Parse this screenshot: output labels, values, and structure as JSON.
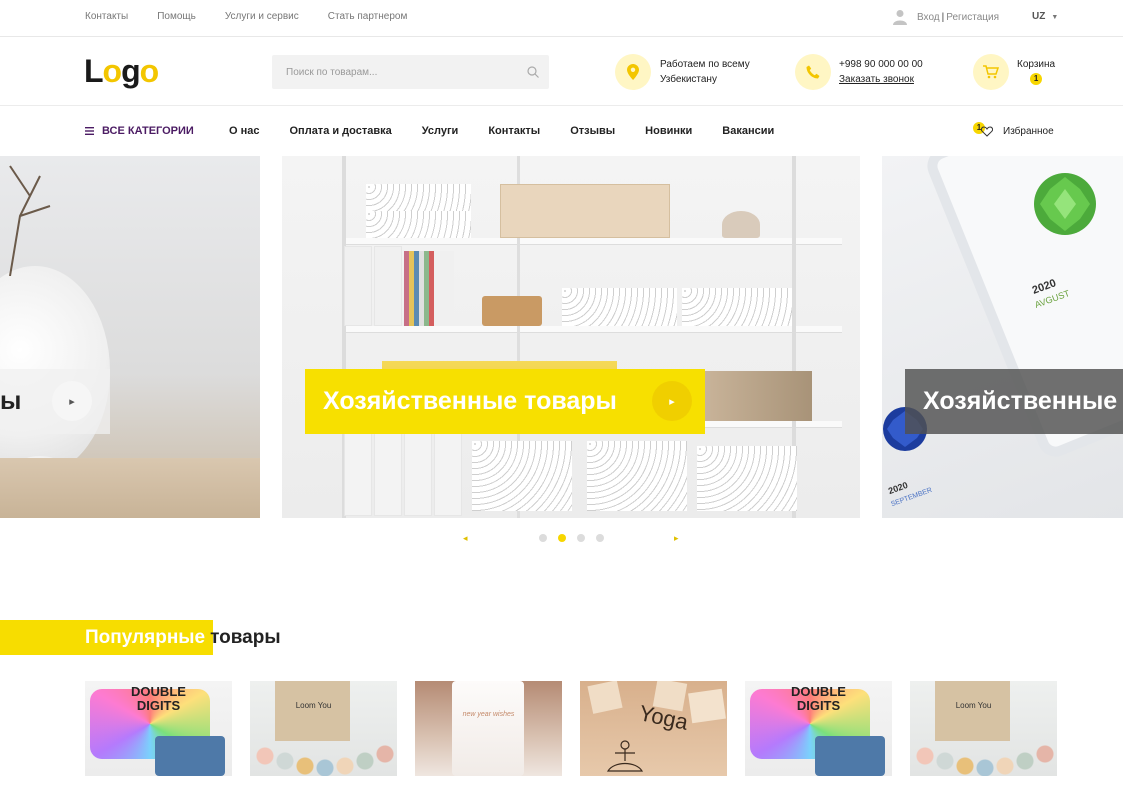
{
  "topbar": {
    "links": [
      "Контакты",
      "Помощь",
      "Услуги и сервис",
      "Стать партнером"
    ],
    "login": "Вход",
    "separator": "|",
    "register": "Регистация",
    "lang": "UZ"
  },
  "header": {
    "logo_l": "L",
    "logo_o1": "o",
    "logo_g": "g",
    "logo_o2": "o",
    "search_placeholder": "Поиск по товарам...",
    "location_line1": "Работаем по всему",
    "location_line2": "Узбекистану",
    "phone": "+998 90 000 00 00",
    "callback": "Заказать звонок",
    "cart_label": "Корзина",
    "cart_count": "1"
  },
  "nav": {
    "all_categories": "ВСЕ КАТЕГОРИИ",
    "items": [
      "О нас",
      "Оплата и доставка",
      "Услуги",
      "Контакты",
      "Отзывы",
      "Новинки",
      "Вакансии"
    ],
    "favorites_label": "Избранное",
    "favorites_count": "1"
  },
  "slider": {
    "left_caption": "ы",
    "center_caption": "Хозяйственные товары",
    "right_caption": "Хозяйственные",
    "calendar_year": "2020",
    "calendar_month": "AVGUST",
    "calendar_year2": "2020",
    "calendar_month2": "SEPTEMBER",
    "active_dot": 2,
    "dot_count": 4
  },
  "popular": {
    "title_highlight": "Популярные",
    "title_rest": "товары"
  },
  "products": [
    {
      "image": "double-digits-tshirt",
      "text1": "DOUBLE",
      "text2": "DIGITS"
    },
    {
      "image": "teether-bag",
      "text1": "Loom You",
      "text2": ""
    },
    {
      "image": "candle",
      "text1": "new year wishes",
      "text2": ""
    },
    {
      "image": "yoga-dice",
      "text1": "Yoga",
      "text2": ""
    },
    {
      "image": "double-digits-tshirt",
      "text1": "DOUBLE",
      "text2": "DIGITS"
    },
    {
      "image": "teether-bag",
      "text1": "Loom You",
      "text2": ""
    }
  ],
  "colors": {
    "accent_yellow": "#f7d600",
    "nav_purple": "#4b1b63",
    "icon_bg": "#fff6c4"
  }
}
